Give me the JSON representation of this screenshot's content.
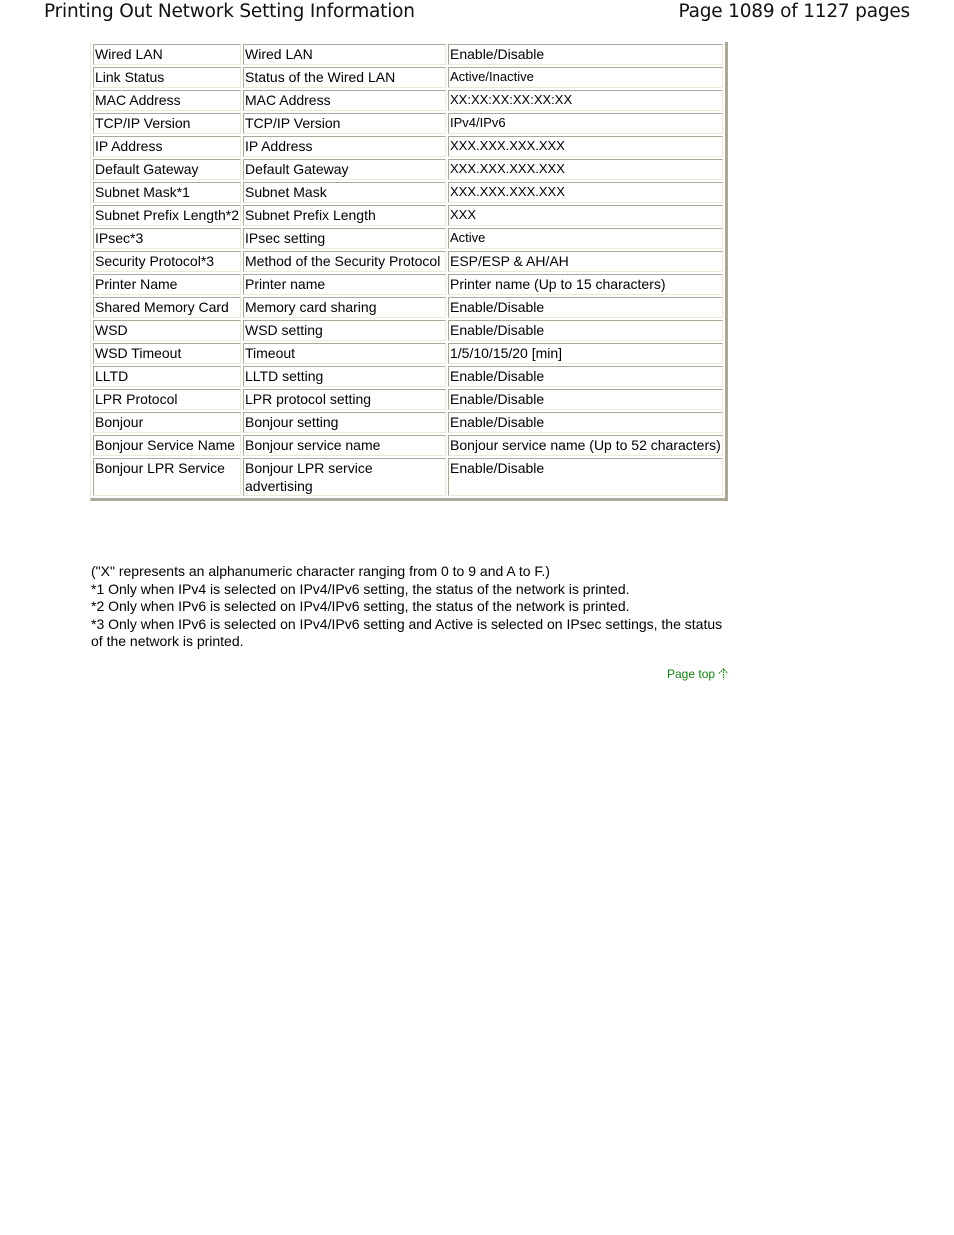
{
  "header": {
    "title": "Printing Out Network Setting Information",
    "page_indicator": "Page 1089 of 1127 pages"
  },
  "table": {
    "rows": [
      {
        "item": "Wired LAN",
        "description": "Wired LAN",
        "setting": "Enable/Disable"
      },
      {
        "item": "Link Status",
        "description": "Status of the Wired LAN",
        "setting": "Active/Inactive"
      },
      {
        "item": "MAC Address",
        "description": "MAC Address",
        "setting": "XX:XX:XX:XX:XX:XX"
      },
      {
        "item": "TCP/IP Version",
        "description": "TCP/IP Version",
        "setting": "IPv4/IPv6"
      },
      {
        "item": "IP Address",
        "description": "IP Address",
        "setting": "XXX.XXX.XXX.XXX"
      },
      {
        "item": "Default Gateway",
        "description": "Default Gateway",
        "setting": "XXX.XXX.XXX.XXX"
      },
      {
        "item": "Subnet Mask*1",
        "description": "Subnet Mask",
        "setting": "XXX.XXX.XXX.XXX"
      },
      {
        "item": "Subnet Prefix Length*2",
        "description": "Subnet Prefix Length",
        "setting": "XXX"
      },
      {
        "item": "IPsec*3",
        "description": "IPsec setting",
        "setting": "Active"
      },
      {
        "item": "Security Protocol*3",
        "description": "Method of the Security Protocol",
        "setting": "ESP/ESP & AH/AH"
      },
      {
        "item": "Printer Name",
        "description": "Printer name",
        "setting": "Printer name (Up to 15 characters)"
      },
      {
        "item": "Shared Memory Card",
        "description": "Memory card sharing",
        "setting": "Enable/Disable"
      },
      {
        "item": "WSD",
        "description": "WSD setting",
        "setting": "Enable/Disable"
      },
      {
        "item": "WSD Timeout",
        "description": "Timeout",
        "setting": "1/5/10/15/20 [min]"
      },
      {
        "item": "LLTD",
        "description": "LLTD setting",
        "setting": "Enable/Disable"
      },
      {
        "item": "LPR Protocol",
        "description": "LPR protocol setting",
        "setting": "Enable/Disable"
      },
      {
        "item": "Bonjour",
        "description": "Bonjour setting",
        "setting": "Enable/Disable"
      },
      {
        "item": "Bonjour Service Name",
        "description": "Bonjour service name",
        "setting": "Bonjour service name (Up to 52 characters)"
      },
      {
        "item": "Bonjour LPR Service",
        "description": "Bonjour LPR service advertising",
        "setting": "Enable/Disable"
      }
    ]
  },
  "notes": [
    "(\"X\" represents an alphanumeric character ranging from 0 to 9 and A to F.)",
    "*1 Only when IPv4 is selected on IPv4/IPv6 setting, the status of the network is printed.",
    "*2 Only when IPv6 is selected on IPv4/IPv6 setting, the status of the network is printed.",
    "*3 Only when IPv6 is selected on IPv4/IPv6 setting and Active is selected on IPsec settings, the status of the network is printed."
  ],
  "page_top": {
    "label": "Page top",
    "icon": "arrow-up-icon",
    "color": "#137f13"
  }
}
